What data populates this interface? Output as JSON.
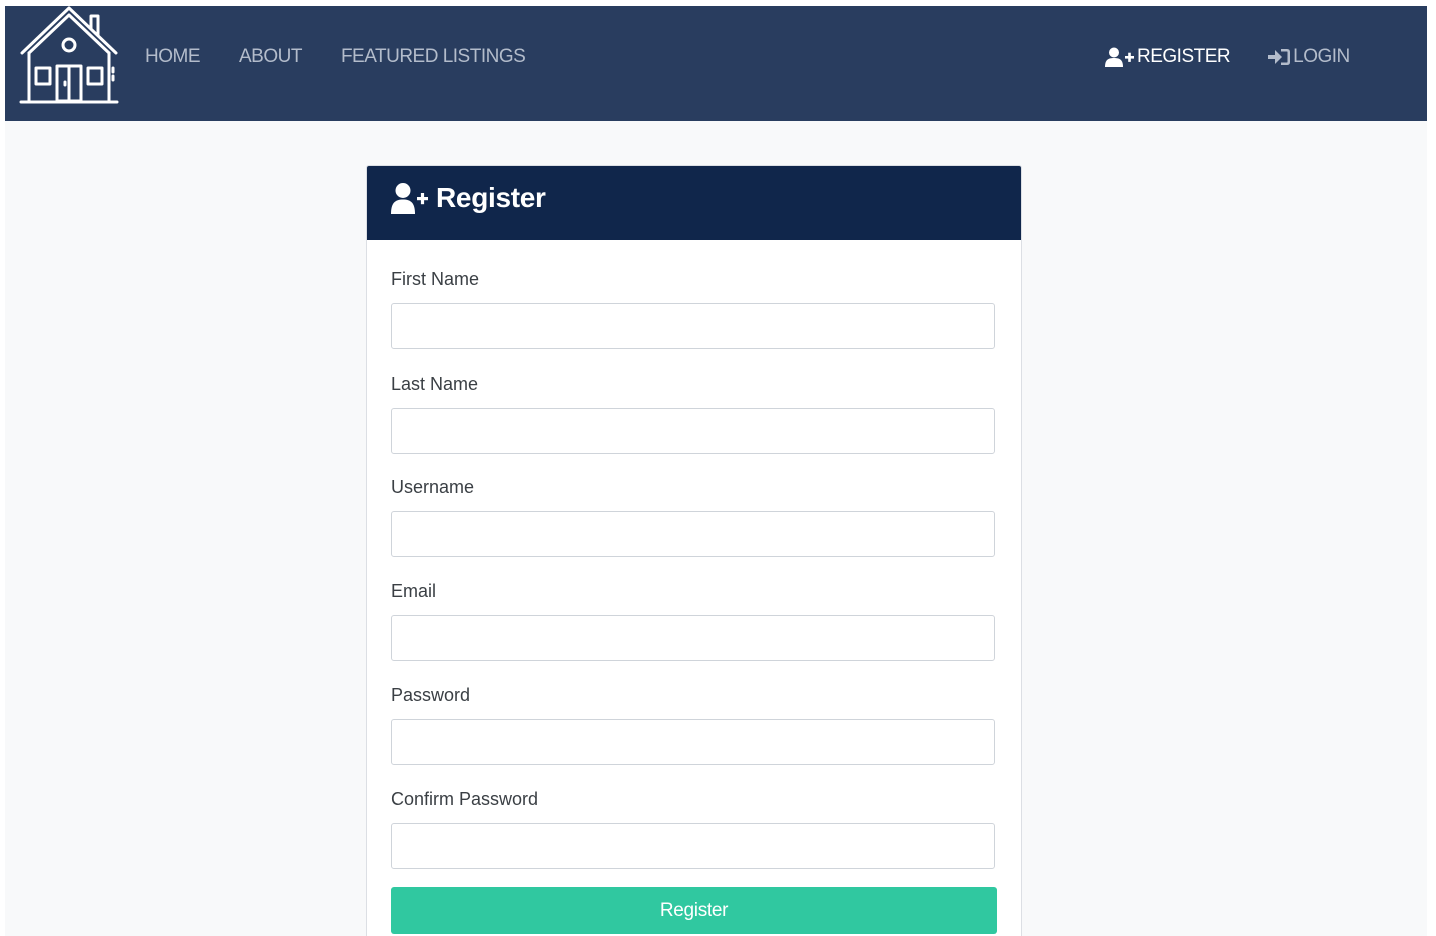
{
  "nav": {
    "links": [
      "HOME",
      "ABOUT",
      "FEATURED LISTINGS"
    ],
    "register_label": "REGISTER",
    "login_label": "LOGIN"
  },
  "card": {
    "title": "Register"
  },
  "form": {
    "fields": [
      {
        "label": "First Name",
        "value": ""
      },
      {
        "label": "Last Name",
        "value": ""
      },
      {
        "label": "Username",
        "value": ""
      },
      {
        "label": "Email",
        "value": ""
      },
      {
        "label": "Password",
        "value": ""
      },
      {
        "label": "Confirm Password",
        "value": ""
      }
    ],
    "submit_label": "Register"
  },
  "icons": {
    "logo": "house-icon",
    "register": "user-plus-icon",
    "login": "sign-in-icon"
  },
  "colors": {
    "navbar": "#293d5f",
    "card_header": "#10264b",
    "accent": "#30c8a0",
    "page_bg": "#f8f9fa"
  }
}
